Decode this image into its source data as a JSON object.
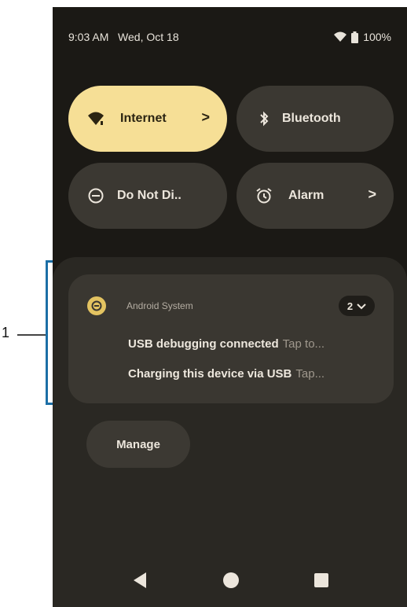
{
  "status_bar": {
    "time": "9:03 AM",
    "date": "Wed, Oct 18",
    "battery": "100%"
  },
  "quick_tiles": [
    {
      "label": "Internet",
      "chevron": ">",
      "icon": "wifi-icon",
      "state": "on"
    },
    {
      "label": "Bluetooth",
      "icon": "bluetooth-icon",
      "state": "off"
    },
    {
      "label": "Do Not Di..",
      "icon": "do-not-disturb-icon",
      "state": "off"
    },
    {
      "label": "Alarm",
      "chevron": ">",
      "icon": "alarm-icon",
      "state": "off"
    }
  ],
  "notification": {
    "app_name": "Android System",
    "count": "2",
    "lines": [
      {
        "title": "USB debugging connected",
        "text": "Tap to..."
      },
      {
        "title": "Charging this device via USB",
        "text": "Tap..."
      }
    ]
  },
  "manage_label": "Manage",
  "callout": {
    "number": "1"
  },
  "colors": {
    "active_tile": "#f6df96",
    "inactive_tile": "#3b3832",
    "background": "#1b1915",
    "bracket": "#1c6fa6"
  }
}
